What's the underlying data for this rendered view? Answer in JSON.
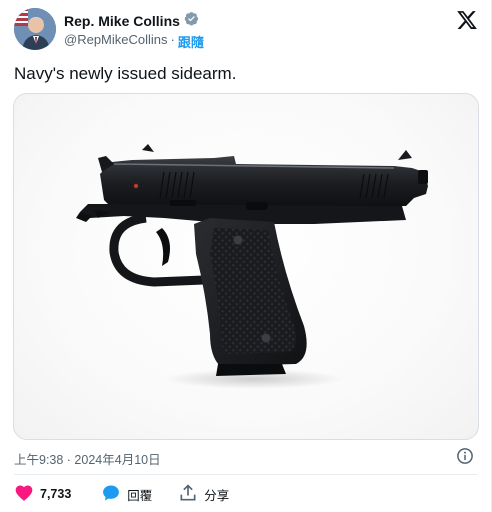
{
  "author": {
    "name": "Rep. Mike Collins",
    "handle": "@RepMikeCollins",
    "separator": "·",
    "follow_label": "跟隨"
  },
  "tweet": {
    "text": "Navy's newly issued sidearm."
  },
  "meta": {
    "timestamp": "上午9:38 · 2024年4月10日"
  },
  "actions": {
    "likes": "7,733",
    "reply_label": "回覆",
    "share_label": "分享"
  },
  "icons": {
    "verified": "verified-badge-icon",
    "platform": "x-logo-icon",
    "info": "info-icon",
    "like": "heart-icon",
    "reply": "speech-bubble-icon",
    "share": "share-upload-icon"
  },
  "colors": {
    "accent": "#1d9bf0",
    "like": "#f91880",
    "text": "#0f1419",
    "secondary": "#536471"
  }
}
